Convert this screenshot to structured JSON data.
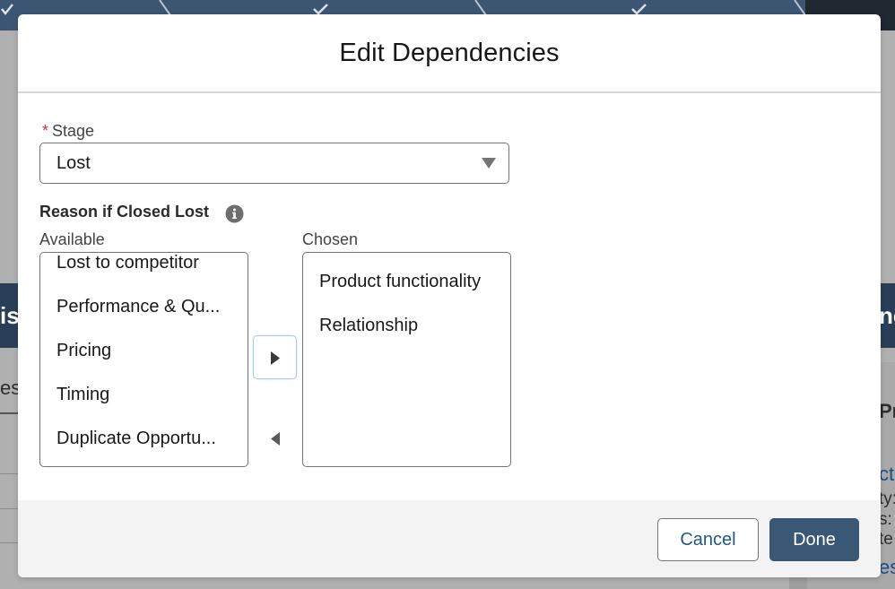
{
  "modal": {
    "title": "Edit Dependencies"
  },
  "stage": {
    "required_marker": "*",
    "label": "Stage",
    "value": "Lost"
  },
  "dual_listbox": {
    "label": "Reason if Closed Lost",
    "available_label": "Available",
    "chosen_label": "Chosen",
    "available": [
      "Lost to competitor",
      "Performance & Qu...",
      "Pricing",
      "Timing",
      "Duplicate Opportu..."
    ],
    "chosen": [
      "Product functionality",
      "Relationship"
    ]
  },
  "footer": {
    "cancel_label": "Cancel",
    "done_label": "Done"
  },
  "background": {
    "band_left_text": "is",
    "band_right_text": "nc",
    "frag_tab": "es",
    "frag_heading": "Pro",
    "frag_link_1": "ct",
    "frag_text_1": "ty:",
    "frag_text_2": "s:",
    "frag_text_3": "te",
    "frag_link_2": "es"
  },
  "colors": {
    "brand_button": "#3a5876",
    "link_text": "#22578a",
    "required": "#c23934",
    "path_bar": "#3b5573"
  },
  "icons": {
    "stage_dropdown": "caret-down-icon",
    "help": "info-icon",
    "move_to_chosen": "caret-right-icon",
    "move_to_available": "caret-left-icon",
    "path_step": "check-icon"
  }
}
